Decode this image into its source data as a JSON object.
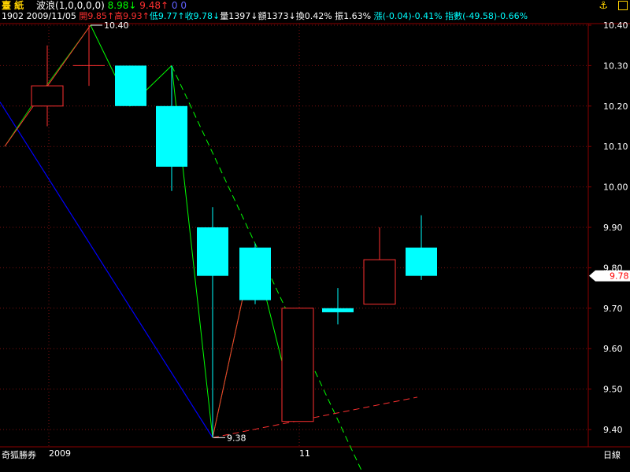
{
  "header": {
    "symbol": "臺 紙",
    "indicator_label": "波浪(1,0,0,0,0)",
    "indicator_v1": "8.98",
    "indicator_v2": "9.48",
    "indicator_v3": "0",
    "indicator_v4": "0",
    "code_date": "1902 2009/11/05",
    "open": "開9.85↑",
    "high": "高9.93↑",
    "low": "低9.77↑",
    "close": "收9.78↓",
    "volume": "量1397↓",
    "amount": "額1373↓",
    "turnover": "換0.42%",
    "amplitude": "振1.63%",
    "change": "漲(-0.04)-0.41%",
    "index": "指數(-49.58)-0.66%"
  },
  "icons": [
    "anchor-icon",
    "box-icon"
  ],
  "footer": {
    "source": "奇狐勝券",
    "year": "2009",
    "month": "11",
    "period": "日線"
  },
  "chart_data": {
    "type": "candlestick",
    "ylim": [
      9.35,
      10.45
    ],
    "yticks": [
      "10.40",
      "10.30",
      "10.20",
      "10.10",
      "10.00",
      "9.90",
      "9.80",
      "9.70",
      "9.60",
      "9.50",
      "9.40"
    ],
    "candles": [
      {
        "open": 10.2,
        "close": 10.25,
        "high": 10.35,
        "low": 10.15,
        "color": "red-hollow"
      },
      {
        "open": 10.3,
        "close": 10.3,
        "high": 10.4,
        "low": 10.25,
        "color": "doji"
      },
      {
        "open": 10.3,
        "close": 10.2,
        "high": 10.3,
        "low": 10.2,
        "color": "cyan"
      },
      {
        "open": 10.2,
        "close": 10.05,
        "high": 10.3,
        "low": 9.99,
        "color": "cyan"
      },
      {
        "open": 9.9,
        "close": 9.78,
        "high": 9.95,
        "low": 9.38,
        "color": "cyan"
      },
      {
        "open": 9.85,
        "close": 9.72,
        "high": 9.86,
        "low": 9.71,
        "color": "cyan"
      },
      {
        "open": 9.42,
        "close": 9.7,
        "high": 9.7,
        "low": 9.42,
        "color": "red-hollow"
      },
      {
        "open": 9.7,
        "close": 9.69,
        "high": 9.75,
        "low": 9.66,
        "color": "cyan"
      },
      {
        "open": 9.71,
        "close": 9.82,
        "high": 9.9,
        "low": 9.71,
        "color": "red-hollow"
      },
      {
        "open": 9.85,
        "close": 9.78,
        "high": 9.93,
        "low": 9.77,
        "color": "cyan"
      }
    ],
    "annotations": [
      {
        "text": "10.40",
        "value": 10.4
      },
      {
        "text": "9.38",
        "value": 9.38
      }
    ],
    "price_marker": "9.78",
    "price_marker_value": 9.78
  }
}
